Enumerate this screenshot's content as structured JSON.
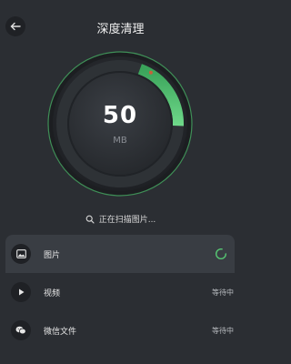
{
  "header": {
    "title": "深度清理",
    "back_icon": "arrow-left-icon"
  },
  "gauge": {
    "value": "50",
    "unit": "MB",
    "progress_fraction": 0.2,
    "accent_color": "#56c873",
    "track_color": "#2e3236"
  },
  "scan": {
    "icon": "search-icon",
    "text": "正在扫描图片..."
  },
  "items": [
    {
      "label": "图片",
      "icon": "image-icon",
      "status": "",
      "state": "scanning"
    },
    {
      "label": "视频",
      "icon": "play-icon",
      "status": "等待中",
      "state": "waiting"
    },
    {
      "label": "微信文件",
      "icon": "wechat-icon",
      "status": "等待中",
      "state": "waiting"
    }
  ]
}
